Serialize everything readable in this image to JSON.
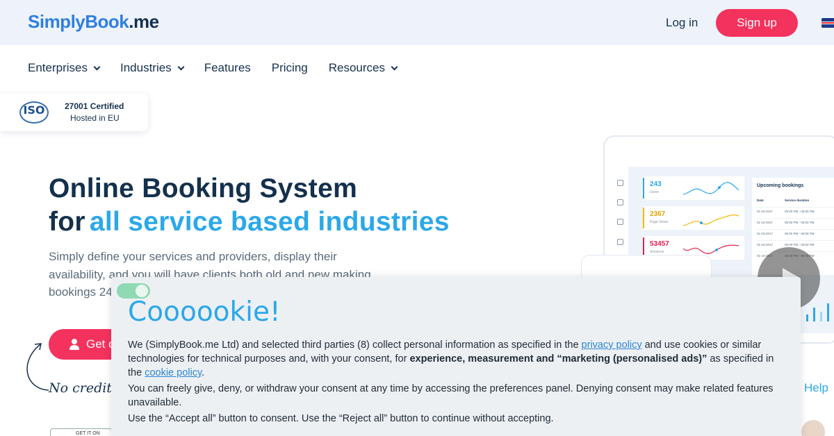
{
  "header": {
    "logo_main": "SimplyBook",
    "logo_suffix": ".me",
    "login": "Log in",
    "signup": "Sign up",
    "language_icon": "uk-flag-icon"
  },
  "nav": {
    "items": [
      {
        "label": "Enterprises",
        "dropdown": true
      },
      {
        "label": "Industries",
        "dropdown": true
      },
      {
        "label": "Features",
        "dropdown": false
      },
      {
        "label": "Pricing",
        "dropdown": false
      },
      {
        "label": "Resources",
        "dropdown": true
      }
    ]
  },
  "iso_badge": {
    "logo": "ISO",
    "line1": "27001 Certified",
    "line2": "Hosted in EU"
  },
  "hero": {
    "title_line1": "Online Booking System",
    "title_line2_prefix": "for",
    "title_line2_accent": "all service based industries",
    "subtitle": "Simply define your services and providers, display their availability, and you will have clients both old and new making bookings 24",
    "cta": "Get c",
    "no_credit": "No credit c",
    "store_badge": "GET IT ON"
  },
  "dashboard": {
    "stats": [
      {
        "value": "243",
        "label": "Users",
        "color": "#2ca8e8"
      },
      {
        "value": "2367",
        "label": "Page Views",
        "color": "#f2b705"
      },
      {
        "value": "53457",
        "label": "Sessions",
        "color": "#e0204d"
      }
    ],
    "upcoming": {
      "title": "Upcoming bookings",
      "col_date": "Date",
      "col_duration": "Service duration",
      "rows": [
        {
          "date": "01-19-2017",
          "time": "05:00 PM - 06:00 PM"
        },
        {
          "date": "01-19-2017",
          "time": "05:00 PM - 06:00 PM"
        },
        {
          "date": "01-19-2017",
          "time": "05:00 PM - 06:00 PM"
        },
        {
          "date": "01-19-2017",
          "time": "05:00 PM - 06:00 PM"
        },
        {
          "date": "01-19-2017",
          "time": "05:00 PM - 06:00 PM"
        }
      ]
    }
  },
  "help": "Help",
  "cookie": {
    "title": "Coooookie!",
    "p1_a": "We (SimplyBook.me Ltd) and selected third parties (8) collect personal information as specified in the ",
    "p1_link1": "privacy policy",
    "p1_b": " and use cookies or similar technologies for technical purposes and, with your consent, for ",
    "p1_bold": "experience, measurement and “marketing (personalised ads)”",
    "p1_c": " as specified in the ",
    "p1_link2": "cookie policy",
    "p1_d": ".",
    "p2": "You can freely give, deny, or withdraw your consent at any time by accessing the preferences panel. Denying consent may make related features unavailable.",
    "p3": "Use the “Accept all” button to consent. Use the “Reject all” button to continue without accepting."
  },
  "colors": {
    "brand_blue": "#2ca8e8",
    "brand_red": "#f4325e",
    "navy": "#14304d"
  }
}
